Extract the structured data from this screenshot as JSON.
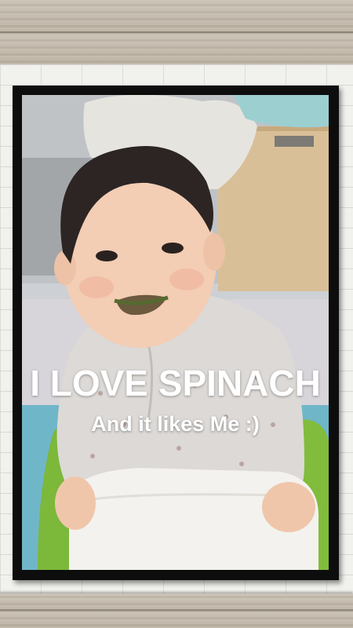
{
  "photo": {
    "caption_main": "I LOVE SPINACH",
    "caption_sub": "And it likes Me :)"
  },
  "colors": {
    "frame": "#0d0d0d",
    "wall": "#f1f1ee",
    "wood": "#c1b8a9",
    "caption": "#ffffff"
  }
}
